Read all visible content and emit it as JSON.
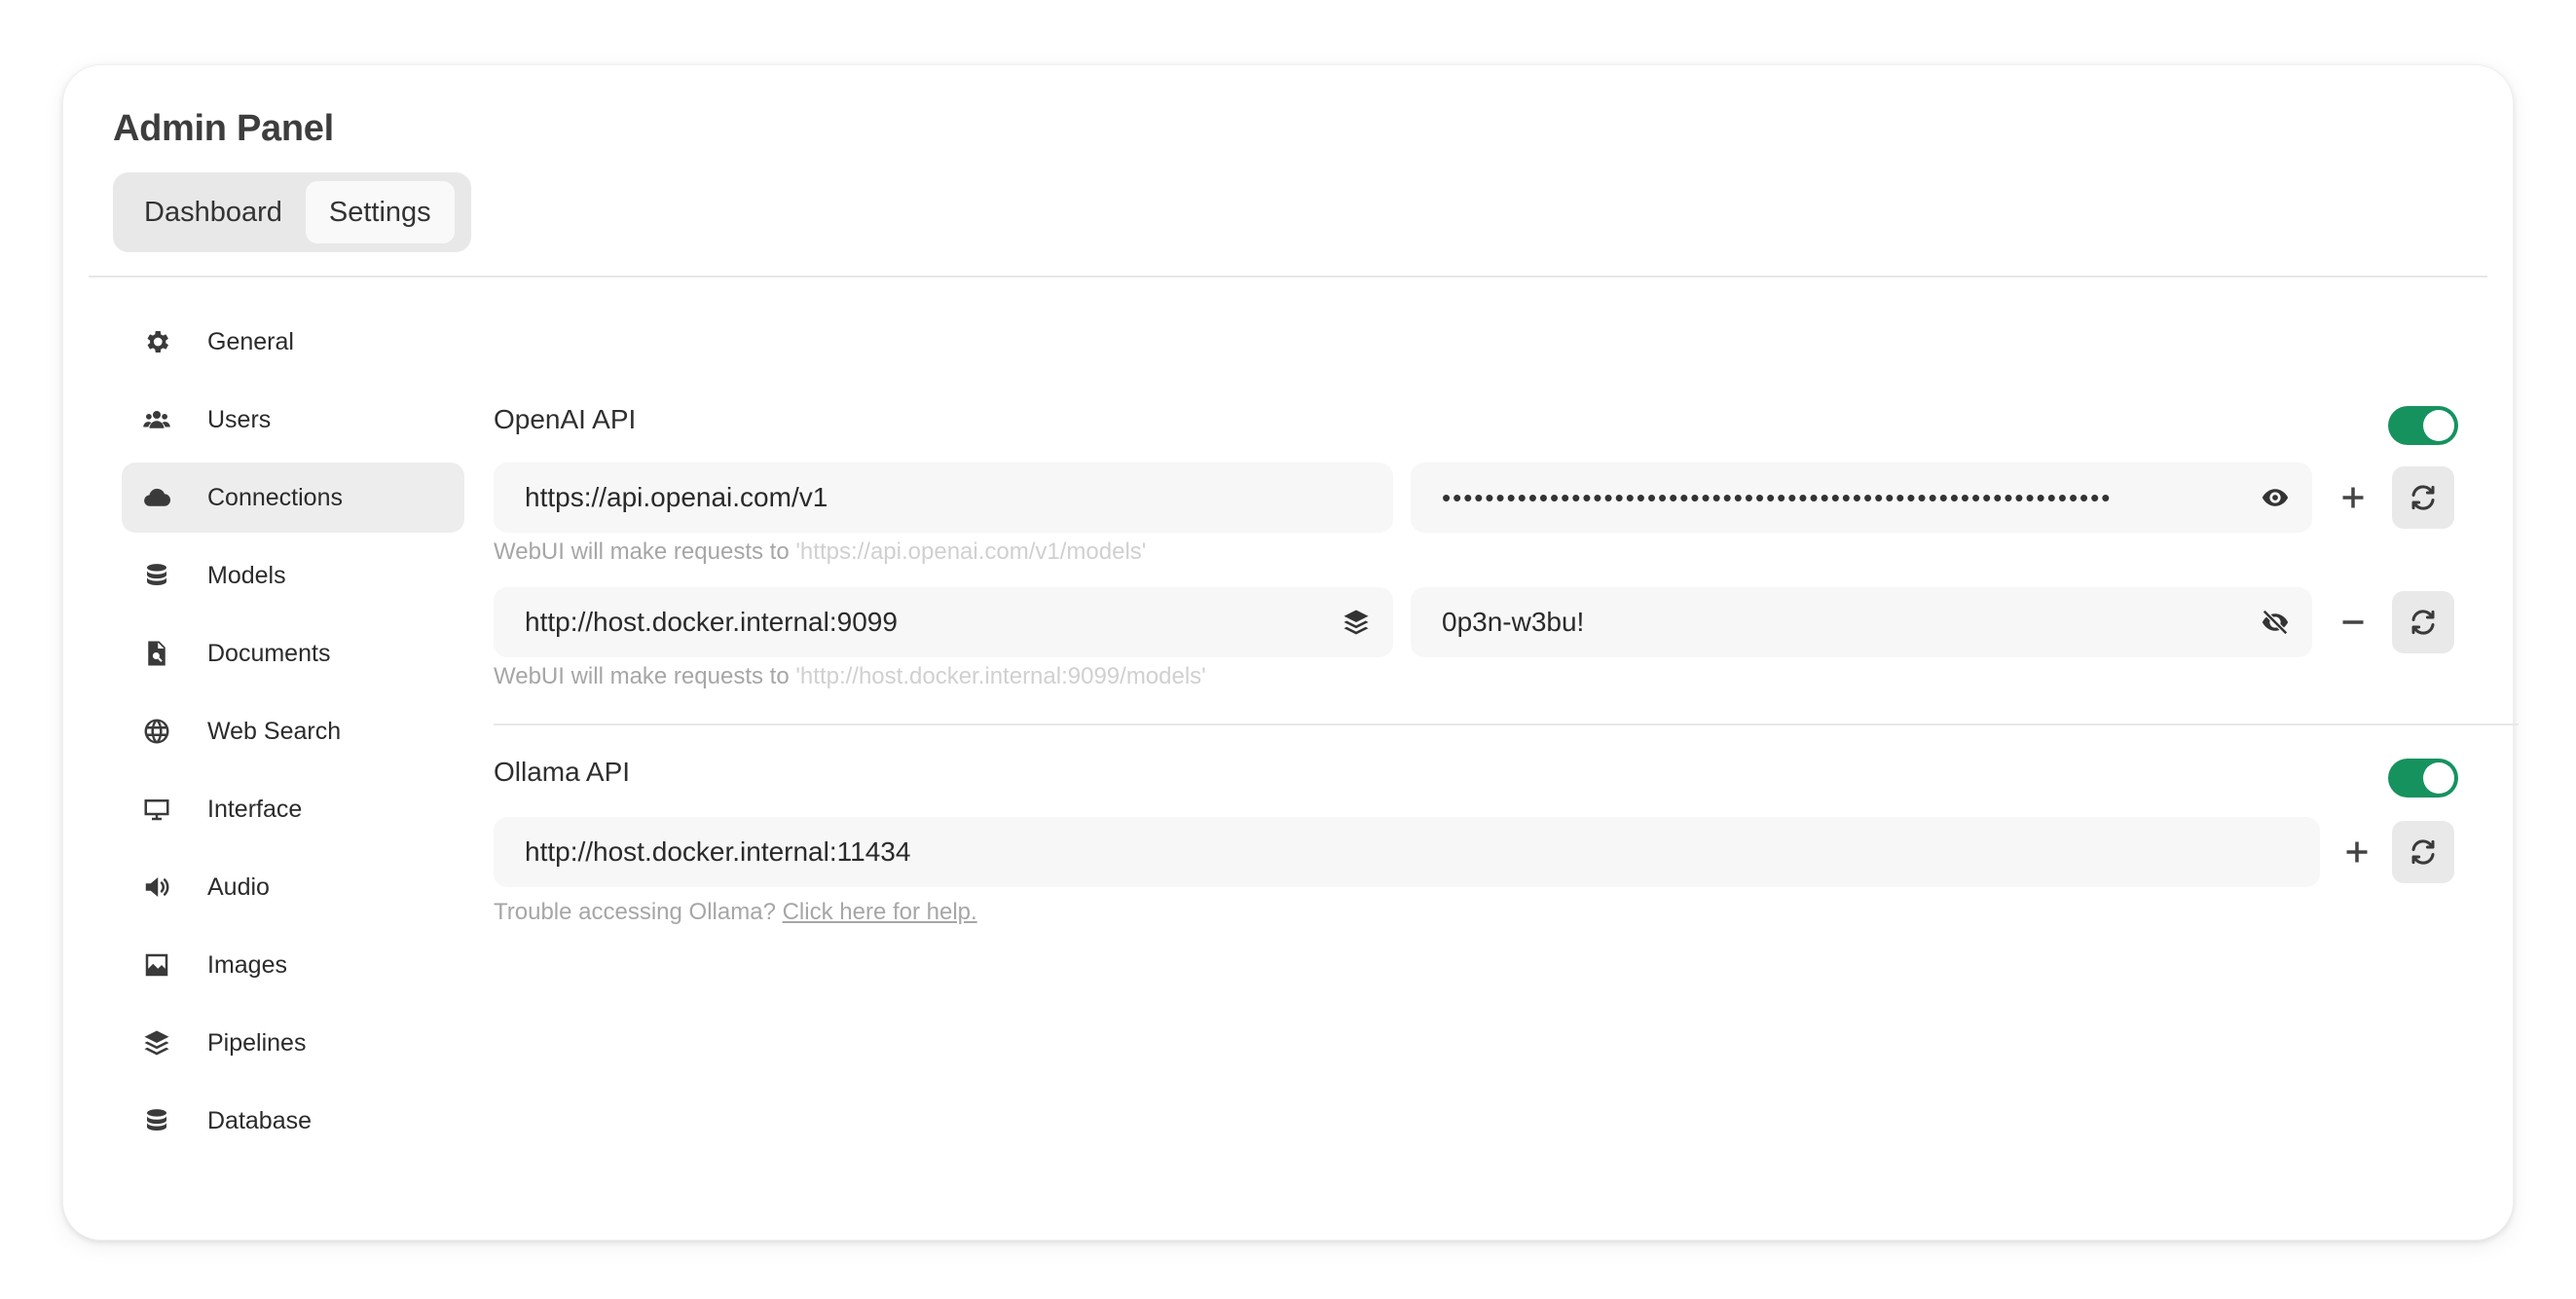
{
  "app": {
    "title": "Admin Panel",
    "tabs": [
      {
        "label": "Dashboard",
        "active": false
      },
      {
        "label": "Settings",
        "active": true
      }
    ]
  },
  "sidebar": {
    "items": [
      {
        "label": "General",
        "icon": "gear-icon"
      },
      {
        "label": "Users",
        "icon": "users-icon"
      },
      {
        "label": "Connections",
        "icon": "cloud-icon",
        "active": true
      },
      {
        "label": "Models",
        "icon": "database-icon"
      },
      {
        "label": "Documents",
        "icon": "document-search-icon"
      },
      {
        "label": "Web Search",
        "icon": "globe-icon"
      },
      {
        "label": "Interface",
        "icon": "monitor-icon"
      },
      {
        "label": "Audio",
        "icon": "speaker-icon"
      },
      {
        "label": "Images",
        "icon": "image-icon"
      },
      {
        "label": "Pipelines",
        "icon": "layers-icon"
      },
      {
        "label": "Database",
        "icon": "database-icon"
      }
    ]
  },
  "openai": {
    "title": "OpenAI API",
    "enabled": true,
    "connections": [
      {
        "url": "https://api.openai.com/v1",
        "key_masked": "••••••••••••••••••••••••••••••••••••••••••••••••••••••••••••••",
        "hint_prefix": "WebUI will make requests to",
        "hint_url": "'https://api.openai.com/v1/models'"
      },
      {
        "url": "http://host.docker.internal:9099",
        "key": "0p3n-w3bu!",
        "hint_prefix": "WebUI will make requests to",
        "hint_url": "'http://host.docker.internal:9099/models'"
      }
    ]
  },
  "ollama": {
    "title": "Ollama API",
    "enabled": true,
    "url": "http://host.docker.internal:11434",
    "hint_prefix": "Trouble accessing Ollama?",
    "hint_link": "Click here for help."
  },
  "colors": {
    "toggle_on": "#16925f",
    "field_bg": "#f7f7f7",
    "active_bg": "#ededed"
  }
}
